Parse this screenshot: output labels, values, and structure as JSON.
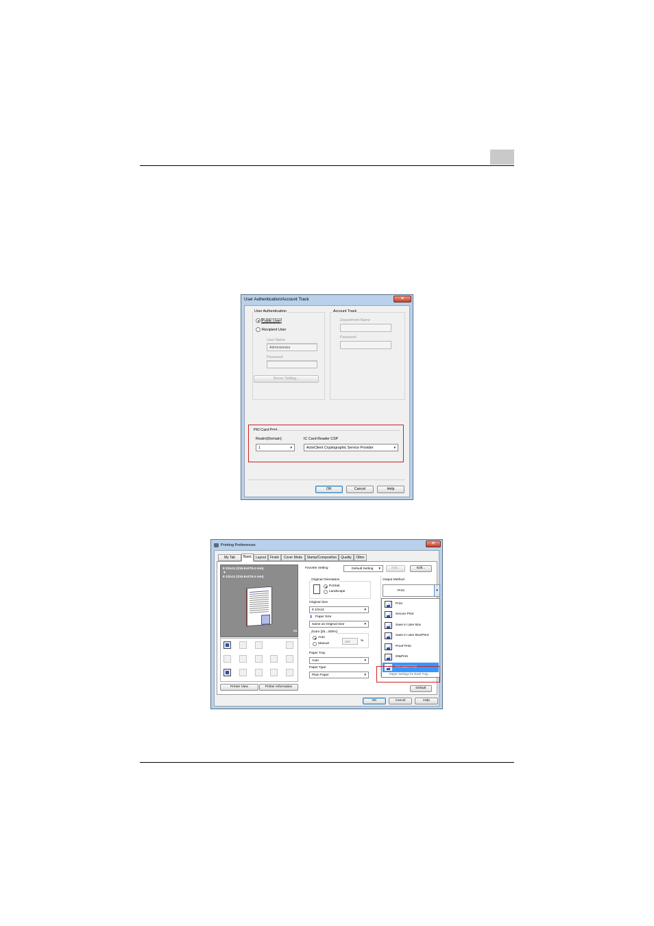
{
  "dialog1": {
    "title": "User Authentication/Account Track",
    "user_auth": {
      "label": "User Authentication",
      "public_user": "Public User",
      "recipient_user": "Recipient User",
      "user_name_label": "User Name",
      "user_name_value": "Administrator",
      "password_label": "Password",
      "server_setting": "Server Setting..."
    },
    "account_track": {
      "label": "Account Track",
      "department_name_label": "Department Name",
      "password_label": "Password"
    },
    "pki": {
      "label": "PKI Card Print",
      "realm_label": "Realm(Domain)",
      "realm_value": "1",
      "csp_label": "IC Card Reader CSP",
      "csp_value": "ActivClient Cryptographic Service Provider"
    },
    "buttons": {
      "ok": "OK",
      "cancel": "Cancel",
      "help": "Help"
    }
  },
  "dialog2": {
    "title": "Printing Preferences",
    "tabs": [
      "My Tab",
      "Basic",
      "Layout",
      "Finish",
      "Cover Mode",
      "Stamp/Composition",
      "Quality",
      "Other"
    ],
    "preview": {
      "line1": "8 1/2x11 (215.9x279.4 mm)",
      "arrow": "▼",
      "line2": "8 1/2x11 (215.9x279.4 mm)",
      "copies": "x1"
    },
    "favorite": {
      "label": "Favorite Setting",
      "value": "Default Setting",
      "add": "Add...",
      "edit": "Edit..."
    },
    "orientation": {
      "label": "Original Orientation",
      "portrait": "Portrait",
      "landscape": "Landscape"
    },
    "original_size": {
      "label": "Original Size",
      "value": "8 1/2x11"
    },
    "paper_size": {
      "label": "Paper Size",
      "value": "Same as Original Size"
    },
    "zoom": {
      "label": "Zoom [25...400%]",
      "auto": "Auto",
      "manual": "Manual",
      "value": "100",
      "unit": "%"
    },
    "paper_tray": {
      "label": "Paper Tray",
      "value": "Auto"
    },
    "paper_type": {
      "label": "Paper Type",
      "value": "Plain Paper"
    },
    "output_method": {
      "label": "Output Method",
      "value": "Print",
      "items": [
        "Print",
        "Secure Print",
        "Save in User Box",
        "Save in User Box/Print",
        "Proof Print",
        "ID&Print",
        "PKI Card Print"
      ],
      "below_text": "Paper Settings for Each Tray..."
    },
    "buttons": {
      "printer_view": "Printer View",
      "printer_information": "Printer Information",
      "default": "Default",
      "ok": "OK",
      "cancel": "Cancel",
      "help": "Help"
    }
  },
  "colors": {
    "highlight_frame": "#d21f1f",
    "selection": "#3399ff",
    "title_bar": "#b9d1ea"
  }
}
